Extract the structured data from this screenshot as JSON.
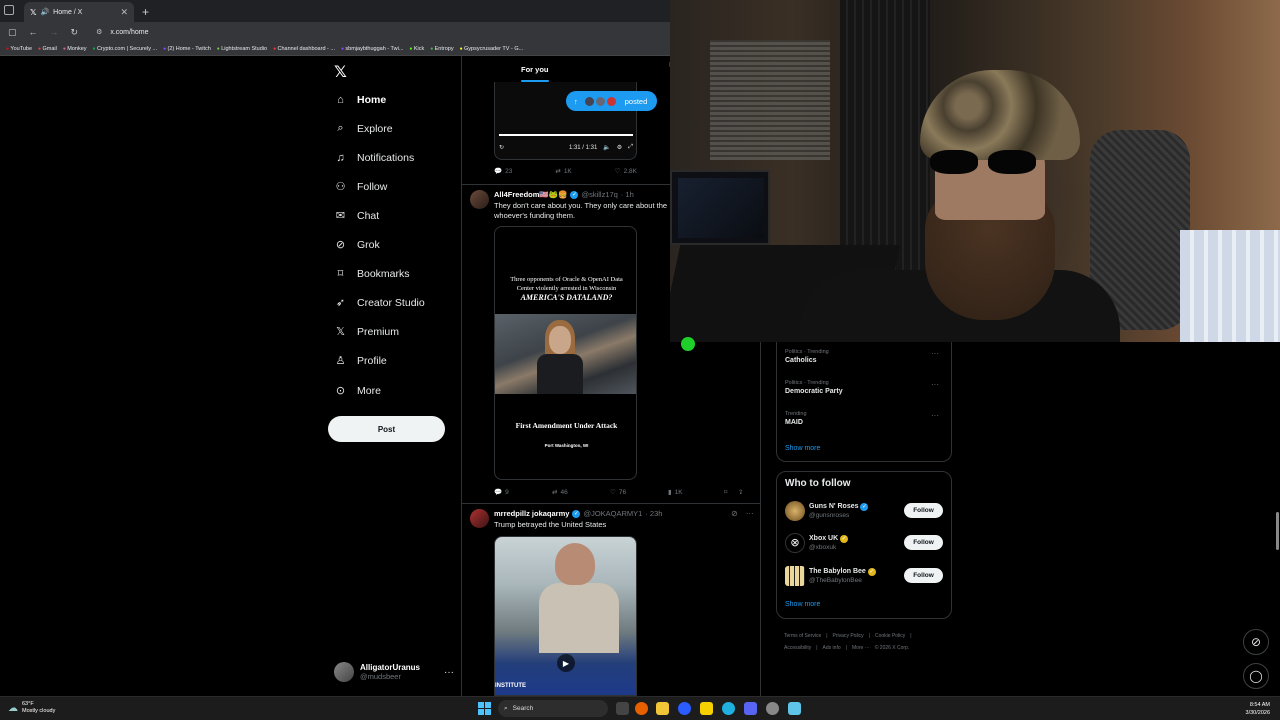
{
  "browser": {
    "tab_title": "Home / X",
    "url": "x.com/home",
    "bookmarks": [
      "YouTube",
      "Gmail",
      "Monkey",
      "Crypto.com | Securely ...",
      "(2) Home - Twitch",
      "Lightstream Studio",
      "Channel dashboard - ...",
      "sbmjaybthuggah - Twi...",
      "Kick",
      "Entropy",
      "Gypsycrusader TV - G..."
    ]
  },
  "sidebar": {
    "items": [
      {
        "label": "Home",
        "icon": "home-icon"
      },
      {
        "label": "Explore",
        "icon": "search-icon"
      },
      {
        "label": "Notifications",
        "icon": "bell-icon"
      },
      {
        "label": "Follow",
        "icon": "person-add-icon"
      },
      {
        "label": "Chat",
        "icon": "mail-icon"
      },
      {
        "label": "Grok",
        "icon": "grok-icon"
      },
      {
        "label": "Bookmarks",
        "icon": "bookmark-icon"
      },
      {
        "label": "Creator Studio",
        "icon": "rocket-icon"
      },
      {
        "label": "Premium",
        "icon": "x-icon"
      },
      {
        "label": "Profile",
        "icon": "person-icon"
      },
      {
        "label": "More",
        "icon": "more-circle-icon"
      }
    ],
    "post_label": "Post",
    "account": {
      "name": "AlligatorUranus",
      "handle": "@mudsbeer"
    }
  },
  "feed": {
    "tab": "For you",
    "posted_pill": "posted",
    "video": {
      "time": "1:31 / 1:31",
      "replies": "23",
      "reposts": "1K",
      "likes": "2.8K"
    },
    "tweets": [
      {
        "name": "All4Freedom🇺🇸🐸🍔",
        "handle": "@skillz17q",
        "age": "· 1h",
        "text": "They don't care about you. They only care about the whoever's funding them.",
        "image": {
          "headline": "Three opponents of Oracle & OpenAI Data Center violently arrested in Wisconsin",
          "headline2": "AMERICA'S DATALAND?",
          "subhead": "First Amendment Under Attack",
          "location": "Port Washington, WI"
        },
        "replies": "9",
        "reposts": "46",
        "likes": "76",
        "views": "1K"
      },
      {
        "name": "mrredpillz jokaqarmy",
        "handle": "@JOKAQARMY1",
        "age": "· 23h",
        "text": "Trump betrayed the United States",
        "image_caption": "INSTITUTE"
      }
    ]
  },
  "trends": [
    {
      "category": "Politics · Trending",
      "topic": "Catholics"
    },
    {
      "category": "Politics · Trending",
      "topic": "Democratic Party"
    },
    {
      "category": "Trending",
      "topic": "MAID"
    }
  ],
  "show_more": "Show more",
  "who_to_follow": {
    "title": "Who to follow",
    "accounts": [
      {
        "name": "Guns N' Roses",
        "handle": "@gunsnroses",
        "button": "Follow"
      },
      {
        "name": "Xbox UK",
        "handle": "@xboxuk",
        "button": "Follow"
      },
      {
        "name": "The Babylon Bee",
        "handle": "@TheBabylonBee",
        "button": "Follow"
      }
    ],
    "show_more": "Show more"
  },
  "footer": [
    "Terms of Service",
    "|",
    "Privacy Policy",
    "|",
    "Cookie Policy",
    "|",
    "Accessibility",
    "|",
    "Ads info",
    "|",
    "More ···",
    "© 2026 X Corp."
  ],
  "taskbar": {
    "temperature": "63°F",
    "weather": "Mostly cloudy",
    "search": "Search",
    "time": "8:54 AM",
    "date": "3/30/2026"
  },
  "colors": {
    "accent": "#1d9bf0",
    "background": "#000000",
    "border": "#2f3336",
    "muted": "#71767b"
  }
}
